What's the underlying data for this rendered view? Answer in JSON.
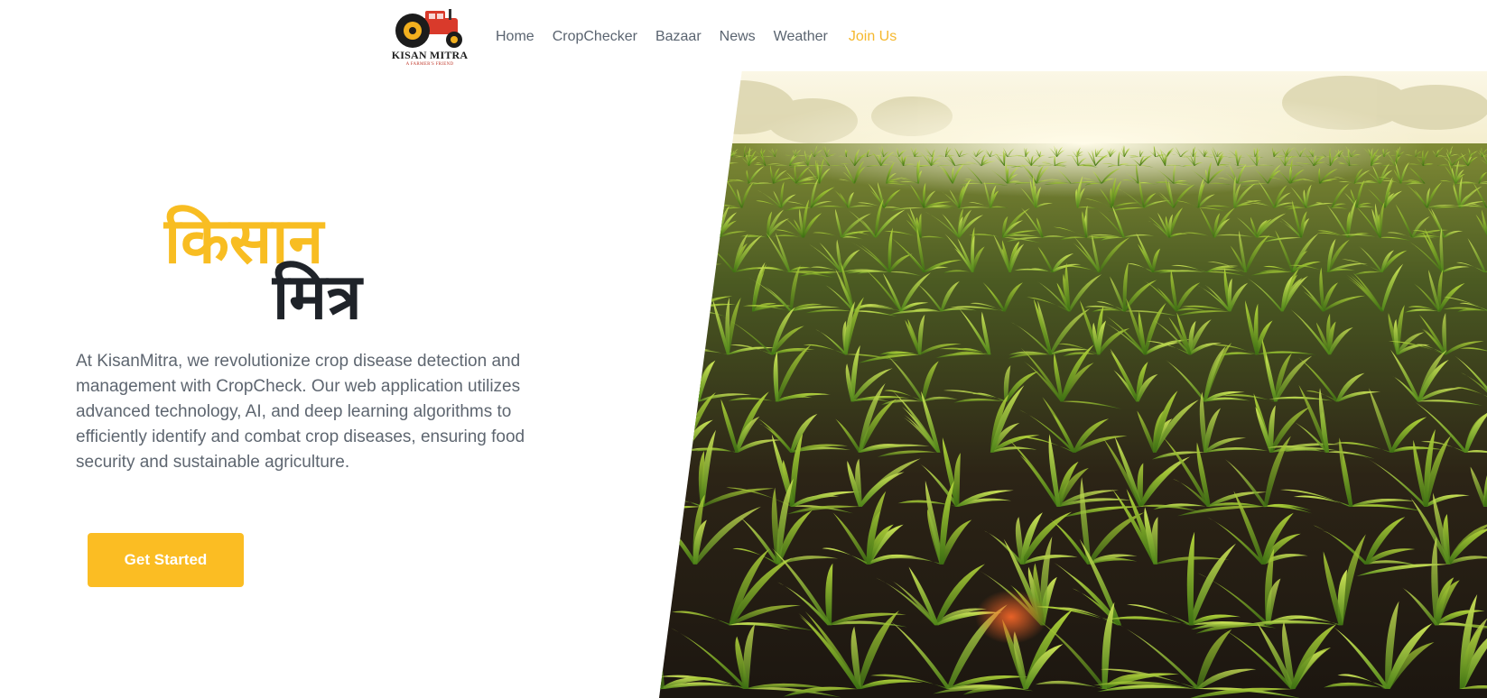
{
  "brand": {
    "name": "KISAN MITRA",
    "tagline": "A FARMER'S FRIEND",
    "logo_icon": "tractor-icon",
    "colors": {
      "tractor_red": "#d93a2b",
      "wheel": "#1c1c1c",
      "hub": "#f2b01e"
    }
  },
  "nav": {
    "items": [
      {
        "label": "Home"
      },
      {
        "label": "CropChecker"
      },
      {
        "label": "Bazaar"
      },
      {
        "label": "News"
      },
      {
        "label": "Weather"
      }
    ],
    "join_label": "Join Us"
  },
  "hero": {
    "title_line1": "किसान",
    "title_line2": "मित्र",
    "description": "At KisanMitra, we revolutionize crop disease detection and management with CropCheck. Our web application utilizes advanced technology, AI, and deep learning algorithms to efficiently identify and combat crop diseases, ensuring food security and sustainable agriculture.",
    "cta_label": "Get Started",
    "image": "corn-field-photo"
  },
  "theme": {
    "accent": "#fbbd23",
    "heading_dark": "#1f2329",
    "nav_text": "#5a6470",
    "body_text": "#5e6670"
  }
}
